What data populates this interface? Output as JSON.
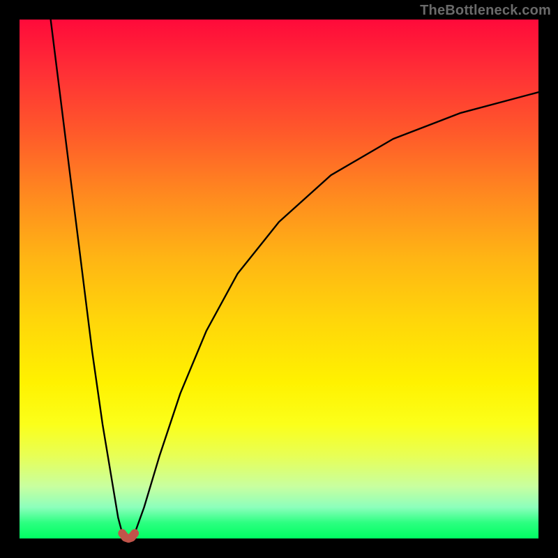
{
  "watermark": "TheBottleneck.com",
  "chart_data": {
    "type": "line",
    "title": "",
    "xlabel": "",
    "ylabel": "",
    "xlim": [
      0,
      100
    ],
    "ylim": [
      0,
      100
    ],
    "grid": false,
    "legend": false,
    "background_gradient": {
      "top": "#ff0a3a",
      "middle": "#fff200",
      "bottom": "#00ff63"
    },
    "series": [
      {
        "name": "left_branch",
        "x": [
          6.0,
          8.0,
          10.0,
          12.0,
          14.0,
          16.0,
          18.0,
          19.0,
          19.8
        ],
        "values": [
          100.0,
          84.0,
          68.0,
          52.0,
          36.0,
          22.0,
          10.0,
          4.0,
          1.0
        ]
      },
      {
        "name": "right_branch",
        "x": [
          22.2,
          24.0,
          27.0,
          31.0,
          36.0,
          42.0,
          50.0,
          60.0,
          72.0,
          85.0,
          100.0
        ],
        "values": [
          1.0,
          6.0,
          16.0,
          28.0,
          40.0,
          51.0,
          61.0,
          70.0,
          77.0,
          82.0,
          86.0
        ]
      },
      {
        "name": "valley_cap",
        "x": [
          19.8,
          20.4,
          21.0,
          21.6,
          22.2
        ],
        "values": [
          1.0,
          0.2,
          0.0,
          0.2,
          1.0
        ],
        "stroke": "#c1544a",
        "stroke_width": 12
      }
    ],
    "valley_x": 21.0
  }
}
